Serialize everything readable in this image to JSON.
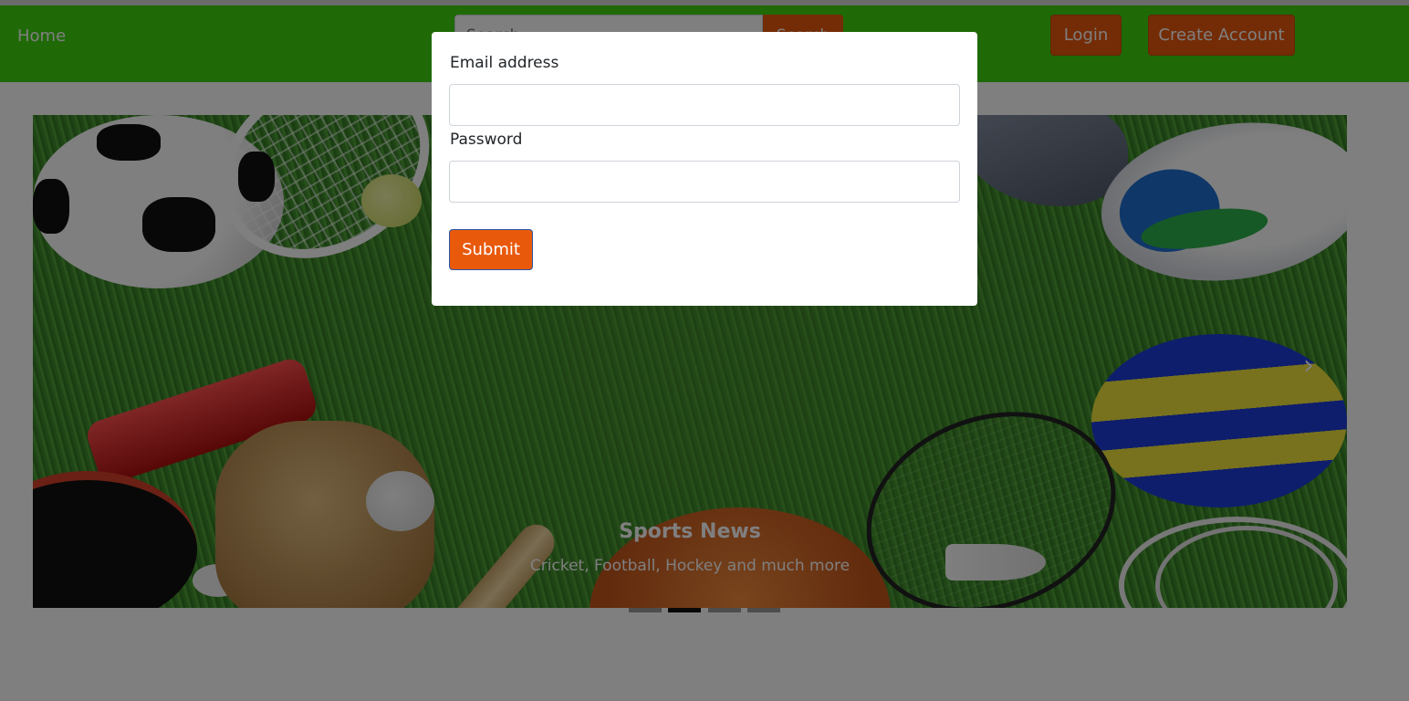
{
  "navbar": {
    "home_label": "Home",
    "search": {
      "placeholder": "Search",
      "button_label": "Search"
    },
    "login_label": "Login",
    "create_account_label": "Create Account"
  },
  "carousel": {
    "caption_title": "Sports News",
    "caption_text": "Cricket, Football, Hockey and much more",
    "next_icon": "›",
    "indicators": 4,
    "active_indicator": 1
  },
  "login_modal": {
    "email_label": "Email address",
    "email_value": "",
    "password_label": "Password",
    "password_value": "",
    "submit_label": "Submit"
  },
  "colors": {
    "navbar": "#3fd40f",
    "accent_button": "#e8590c",
    "overlay": "rgba(0,0,0,0.5)"
  }
}
